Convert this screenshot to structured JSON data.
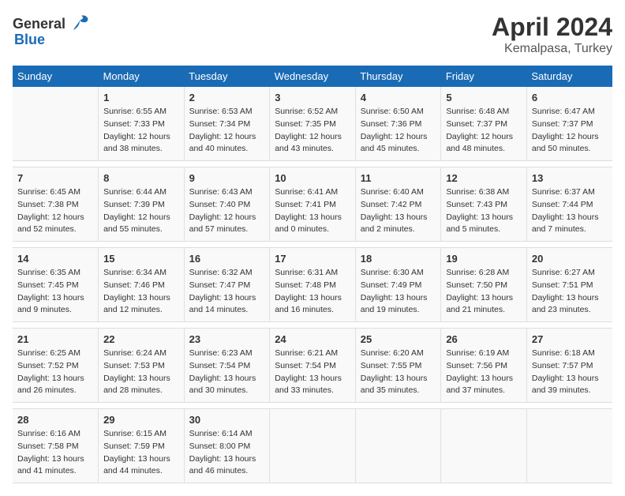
{
  "logo": {
    "general": "General",
    "blue": "Blue"
  },
  "title": "April 2024",
  "subtitle": "Kemalpasa, Turkey",
  "days_header": [
    "Sunday",
    "Monday",
    "Tuesday",
    "Wednesday",
    "Thursday",
    "Friday",
    "Saturday"
  ],
  "weeks": [
    [
      {
        "day": "",
        "info": ""
      },
      {
        "day": "1",
        "info": "Sunrise: 6:55 AM\nSunset: 7:33 PM\nDaylight: 12 hours\nand 38 minutes."
      },
      {
        "day": "2",
        "info": "Sunrise: 6:53 AM\nSunset: 7:34 PM\nDaylight: 12 hours\nand 40 minutes."
      },
      {
        "day": "3",
        "info": "Sunrise: 6:52 AM\nSunset: 7:35 PM\nDaylight: 12 hours\nand 43 minutes."
      },
      {
        "day": "4",
        "info": "Sunrise: 6:50 AM\nSunset: 7:36 PM\nDaylight: 12 hours\nand 45 minutes."
      },
      {
        "day": "5",
        "info": "Sunrise: 6:48 AM\nSunset: 7:37 PM\nDaylight: 12 hours\nand 48 minutes."
      },
      {
        "day": "6",
        "info": "Sunrise: 6:47 AM\nSunset: 7:37 PM\nDaylight: 12 hours\nand 50 minutes."
      }
    ],
    [
      {
        "day": "7",
        "info": "Sunrise: 6:45 AM\nSunset: 7:38 PM\nDaylight: 12 hours\nand 52 minutes."
      },
      {
        "day": "8",
        "info": "Sunrise: 6:44 AM\nSunset: 7:39 PM\nDaylight: 12 hours\nand 55 minutes."
      },
      {
        "day": "9",
        "info": "Sunrise: 6:43 AM\nSunset: 7:40 PM\nDaylight: 12 hours\nand 57 minutes."
      },
      {
        "day": "10",
        "info": "Sunrise: 6:41 AM\nSunset: 7:41 PM\nDaylight: 13 hours\nand 0 minutes."
      },
      {
        "day": "11",
        "info": "Sunrise: 6:40 AM\nSunset: 7:42 PM\nDaylight: 13 hours\nand 2 minutes."
      },
      {
        "day": "12",
        "info": "Sunrise: 6:38 AM\nSunset: 7:43 PM\nDaylight: 13 hours\nand 5 minutes."
      },
      {
        "day": "13",
        "info": "Sunrise: 6:37 AM\nSunset: 7:44 PM\nDaylight: 13 hours\nand 7 minutes."
      }
    ],
    [
      {
        "day": "14",
        "info": "Sunrise: 6:35 AM\nSunset: 7:45 PM\nDaylight: 13 hours\nand 9 minutes."
      },
      {
        "day": "15",
        "info": "Sunrise: 6:34 AM\nSunset: 7:46 PM\nDaylight: 13 hours\nand 12 minutes."
      },
      {
        "day": "16",
        "info": "Sunrise: 6:32 AM\nSunset: 7:47 PM\nDaylight: 13 hours\nand 14 minutes."
      },
      {
        "day": "17",
        "info": "Sunrise: 6:31 AM\nSunset: 7:48 PM\nDaylight: 13 hours\nand 16 minutes."
      },
      {
        "day": "18",
        "info": "Sunrise: 6:30 AM\nSunset: 7:49 PM\nDaylight: 13 hours\nand 19 minutes."
      },
      {
        "day": "19",
        "info": "Sunrise: 6:28 AM\nSunset: 7:50 PM\nDaylight: 13 hours\nand 21 minutes."
      },
      {
        "day": "20",
        "info": "Sunrise: 6:27 AM\nSunset: 7:51 PM\nDaylight: 13 hours\nand 23 minutes."
      }
    ],
    [
      {
        "day": "21",
        "info": "Sunrise: 6:25 AM\nSunset: 7:52 PM\nDaylight: 13 hours\nand 26 minutes."
      },
      {
        "day": "22",
        "info": "Sunrise: 6:24 AM\nSunset: 7:53 PM\nDaylight: 13 hours\nand 28 minutes."
      },
      {
        "day": "23",
        "info": "Sunrise: 6:23 AM\nSunset: 7:54 PM\nDaylight: 13 hours\nand 30 minutes."
      },
      {
        "day": "24",
        "info": "Sunrise: 6:21 AM\nSunset: 7:54 PM\nDaylight: 13 hours\nand 33 minutes."
      },
      {
        "day": "25",
        "info": "Sunrise: 6:20 AM\nSunset: 7:55 PM\nDaylight: 13 hours\nand 35 minutes."
      },
      {
        "day": "26",
        "info": "Sunrise: 6:19 AM\nSunset: 7:56 PM\nDaylight: 13 hours\nand 37 minutes."
      },
      {
        "day": "27",
        "info": "Sunrise: 6:18 AM\nSunset: 7:57 PM\nDaylight: 13 hours\nand 39 minutes."
      }
    ],
    [
      {
        "day": "28",
        "info": "Sunrise: 6:16 AM\nSunset: 7:58 PM\nDaylight: 13 hours\nand 41 minutes."
      },
      {
        "day": "29",
        "info": "Sunrise: 6:15 AM\nSunset: 7:59 PM\nDaylight: 13 hours\nand 44 minutes."
      },
      {
        "day": "30",
        "info": "Sunrise: 6:14 AM\nSunset: 8:00 PM\nDaylight: 13 hours\nand 46 minutes."
      },
      {
        "day": "",
        "info": ""
      },
      {
        "day": "",
        "info": ""
      },
      {
        "day": "",
        "info": ""
      },
      {
        "day": "",
        "info": ""
      }
    ]
  ]
}
